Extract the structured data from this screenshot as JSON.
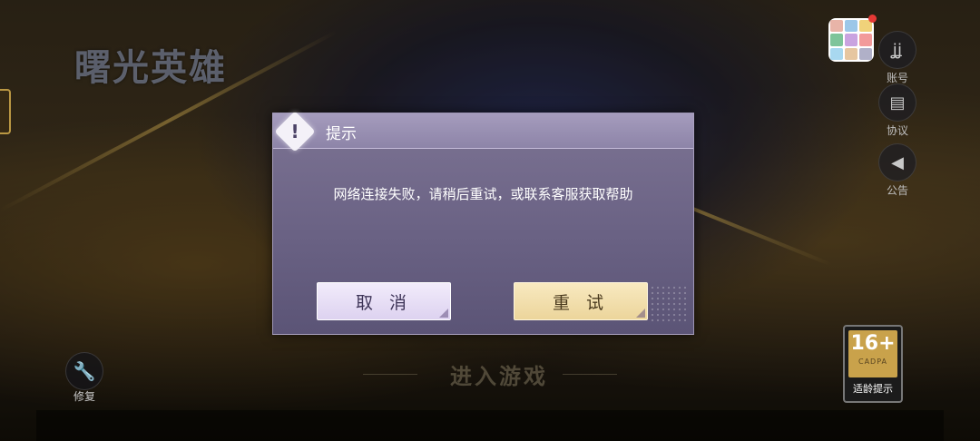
{
  "logo": {
    "title": "曙光英雄"
  },
  "top_right": {
    "account_label": "账号",
    "agreement_label": "协议",
    "notice_label": "公告"
  },
  "repair": {
    "label": "修复"
  },
  "enter_game": {
    "label": "进入游戏"
  },
  "age_rating": {
    "rating": "16+",
    "org": "CADPA",
    "tip": "适龄提示"
  },
  "dialog": {
    "title": "提示",
    "message": "网络连接失败，请稍后重试，或联系客服获取帮助",
    "cancel_label": "取 消",
    "retry_label": "重 试"
  },
  "colors": {
    "dialog_bg": "#6a6284",
    "dialog_header": "#8d84a8",
    "cancel_button": "#e8e0f5",
    "retry_button": "#f1dfa8"
  }
}
